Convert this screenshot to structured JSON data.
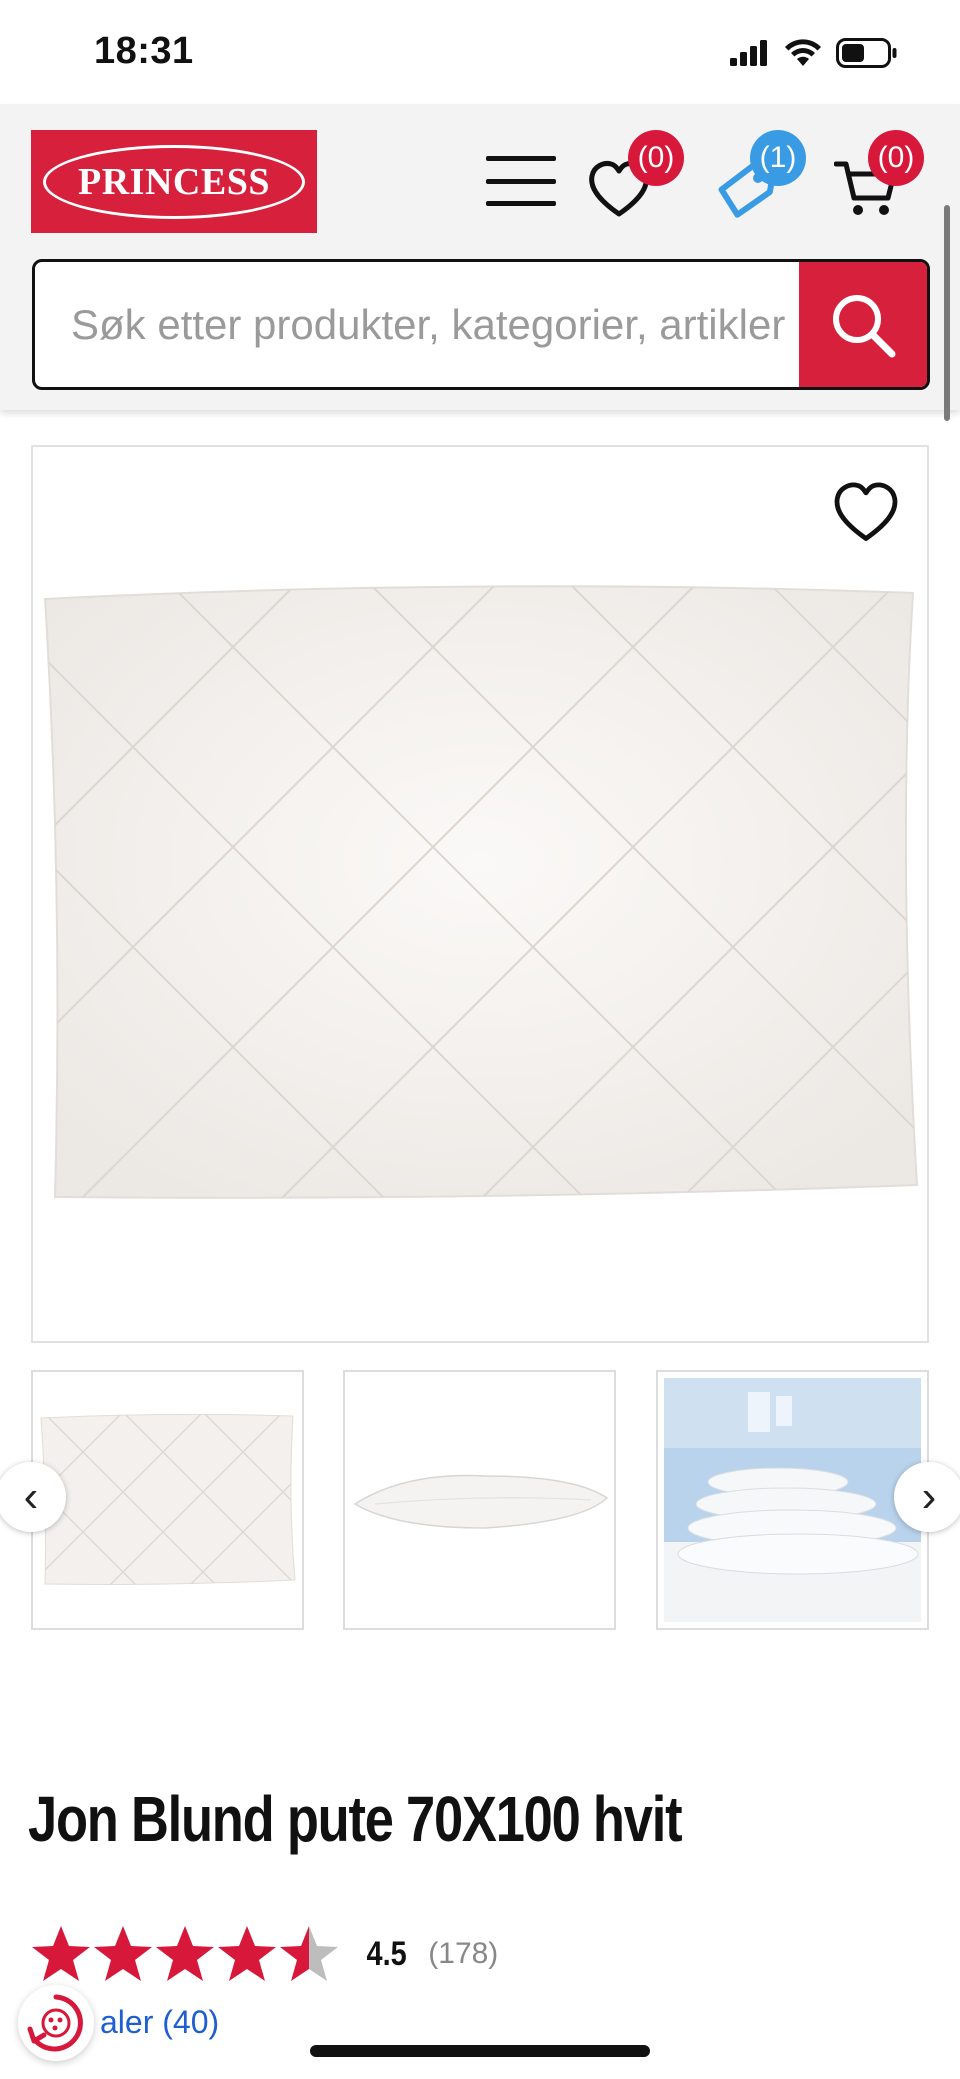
{
  "status_bar": {
    "time": "18:31"
  },
  "header": {
    "logo_text": "PRINCESS",
    "wishlist_count": "(0)",
    "loyalty_count": "(1)",
    "cart_count": "(0)"
  },
  "search": {
    "placeholder": "Søk etter produkter, kategorier, artikler"
  },
  "gallery": {
    "prev_label": "‹",
    "next_label": "›"
  },
  "product": {
    "title": "Jon Blund pute 70X100 hvit",
    "rating_value": "4.5",
    "rating_fraction": 0.9,
    "rating_count": "(178)",
    "reviews_link": "aler (40)"
  },
  "colors": {
    "brand_red": "#d7203c",
    "badge_blue": "#3a9be5",
    "star_red": "#d7183a",
    "star_grey": "#bdbdbd",
    "link_blue": "#1f5ecf"
  },
  "icons": [
    "signal-icon",
    "wifi-icon",
    "battery-icon",
    "menu-icon",
    "heart-icon",
    "tag-icon",
    "cart-icon",
    "search-icon",
    "chevron-left-icon",
    "chevron-right-icon",
    "star-icon",
    "chat-icon"
  ]
}
